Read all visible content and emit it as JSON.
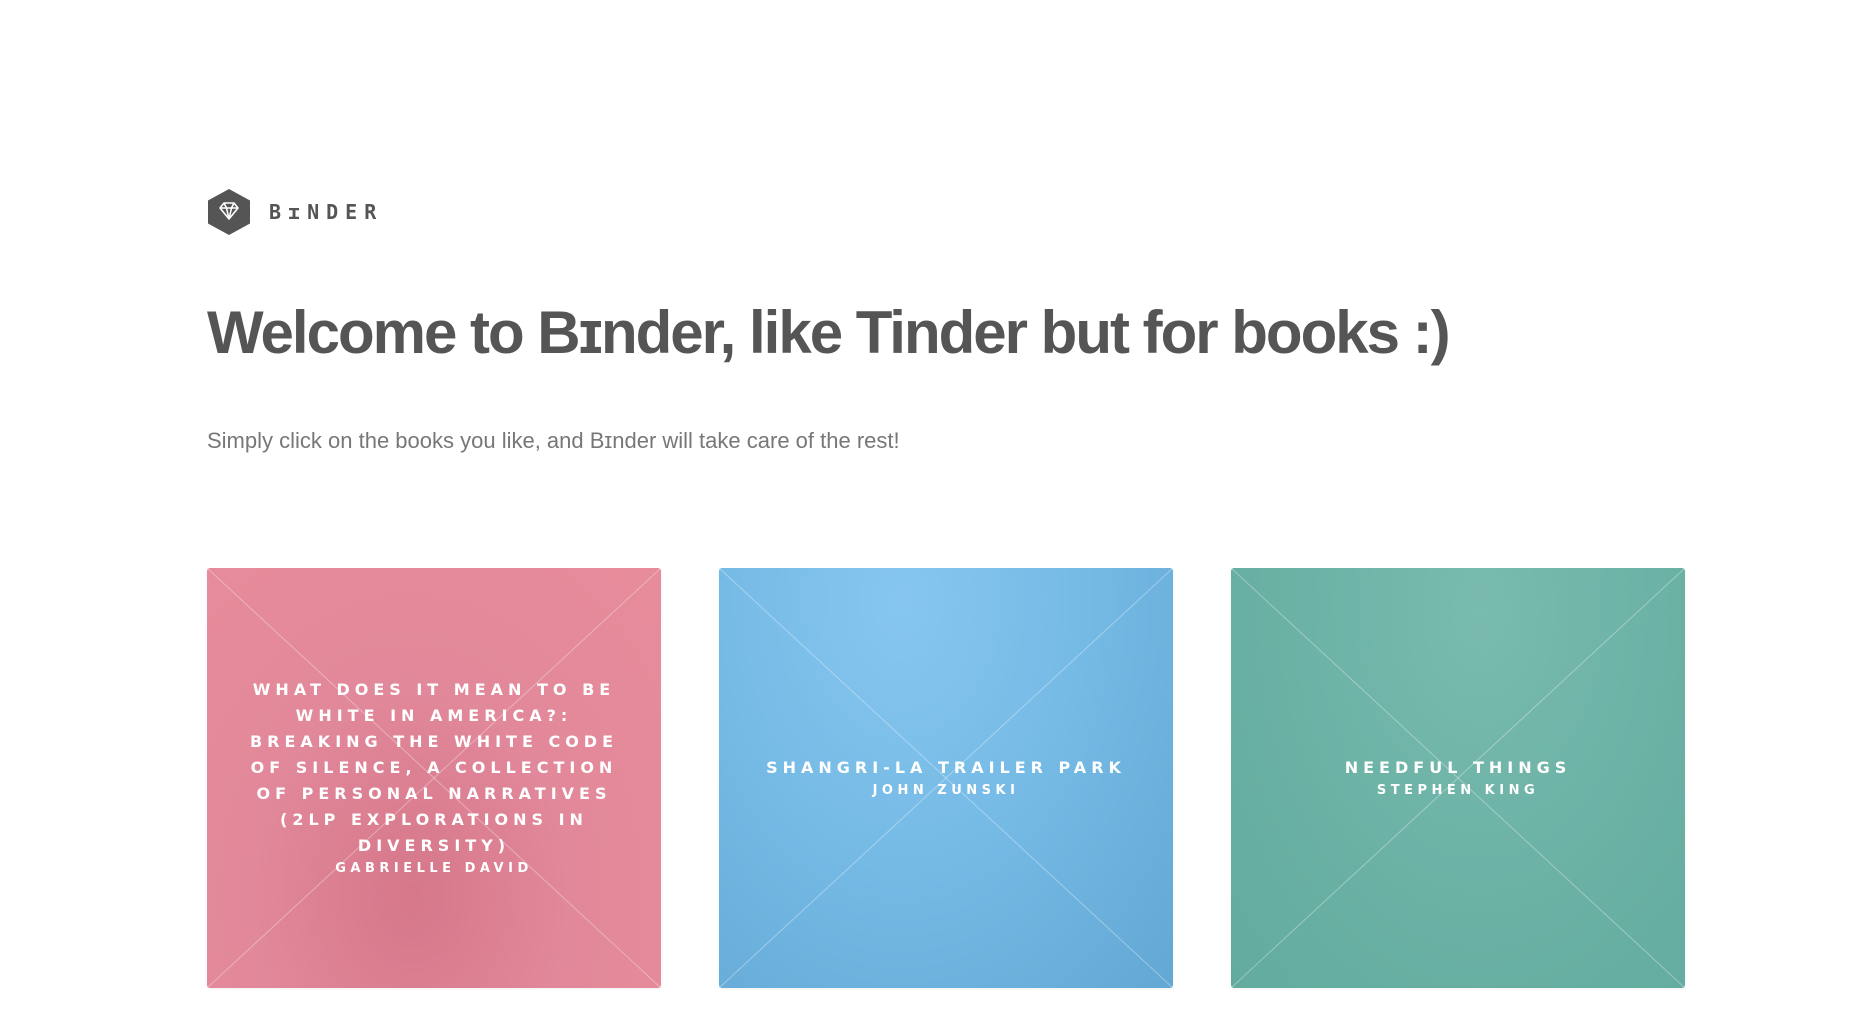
{
  "brand": {
    "name": "BɪNDER",
    "logo_icon": "diamond-icon"
  },
  "hero": {
    "title": "Welcome to Bɪnder, like Tinder but for books :)",
    "subtitle": "Simply click on the books you like, and Bɪnder will take care of the rest!"
  },
  "books": [
    {
      "title": "WHAT DOES IT MEAN TO BE WHITE IN AMERICA?: BREAKING THE WHITE CODE OF SILENCE, A COLLECTION OF PERSONAL NARRATIVES (2LP EXPLORATIONS IN DIVERSITY)",
      "author": "GABRIELLE DAVID",
      "color": "#e1889a"
    },
    {
      "title": "SHANGRI-LA TRAILER PARK",
      "author": "JOHN ZUNSKI",
      "color": "#76bbe6"
    },
    {
      "title": "NEEDFUL THINGS",
      "author": "STEPHEN KING",
      "color": "#6db3a6"
    }
  ],
  "colors": {
    "text": "#555555",
    "subtitle": "#777777",
    "card_text": "#ffffff"
  }
}
